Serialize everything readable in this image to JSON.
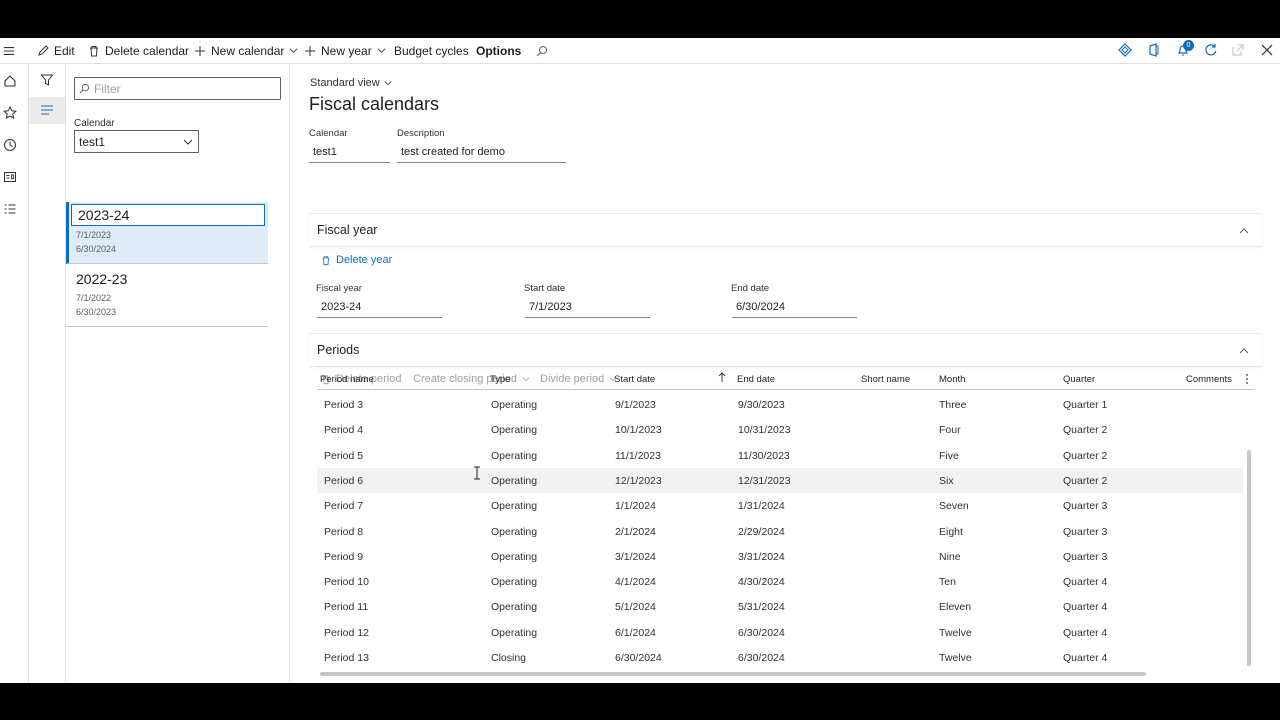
{
  "action_bar": {
    "edit": "Edit",
    "delete_calendar": "Delete calendar",
    "new_calendar": "New calendar",
    "new_year": "New year",
    "budget_cycles": "Budget cycles",
    "options": "Options",
    "notification_count": "0"
  },
  "list": {
    "filter_placeholder": "Filter",
    "calendar_label": "Calendar",
    "calendar_value": "test1",
    "items": [
      {
        "title": "2023-24",
        "start": "7/1/2023",
        "end": "6/30/2024",
        "selected": true
      },
      {
        "title": "2022-23",
        "start": "7/1/2022",
        "end": "6/30/2023",
        "selected": false
      }
    ]
  },
  "main": {
    "view_name": "Standard view",
    "title": "Fiscal calendars",
    "calendar_label": "Calendar",
    "calendar_value": "test1",
    "description_label": "Description",
    "description_value": "test created for demo"
  },
  "fiscal_year_section": {
    "title": "Fiscal year",
    "delete_year": "Delete year",
    "fiscal_year_label": "Fiscal year",
    "fiscal_year_value": "2023-24",
    "start_date_label": "Start date",
    "start_date_value": "7/1/2023",
    "end_date_label": "End date",
    "end_date_value": "6/30/2024"
  },
  "periods_section": {
    "title": "Periods",
    "delete_period": "Delete period",
    "create_closing_period": "Create closing period",
    "divide_period": "Divide period",
    "columns": [
      "Period name",
      "Type",
      "Start date",
      "End date",
      "Short name",
      "Month",
      "Quarter",
      "Comments"
    ],
    "rows": [
      [
        "Period 3",
        "Operating",
        "9/1/2023",
        "9/30/2023",
        "",
        "Three",
        "Quarter 1",
        ""
      ],
      [
        "Period 4",
        "Operating",
        "10/1/2023",
        "10/31/2023",
        "",
        "Four",
        "Quarter 2",
        ""
      ],
      [
        "Period 5",
        "Operating",
        "11/1/2023",
        "11/30/2023",
        "",
        "Five",
        "Quarter 2",
        ""
      ],
      [
        "Period 6",
        "Operating",
        "12/1/2023",
        "12/31/2023",
        "",
        "Six",
        "Quarter 2",
        ""
      ],
      [
        "Period 7",
        "Operating",
        "1/1/2024",
        "1/31/2024",
        "",
        "Seven",
        "Quarter 3",
        ""
      ],
      [
        "Period 8",
        "Operating",
        "2/1/2024",
        "2/29/2024",
        "",
        "Eight",
        "Quarter 3",
        ""
      ],
      [
        "Period 9",
        "Operating",
        "3/1/2024",
        "3/31/2024",
        "",
        "Nine",
        "Quarter 3",
        ""
      ],
      [
        "Period 10",
        "Operating",
        "4/1/2024",
        "4/30/2024",
        "",
        "Ten",
        "Quarter 4",
        ""
      ],
      [
        "Period 11",
        "Operating",
        "5/1/2024",
        "5/31/2024",
        "",
        "Eleven",
        "Quarter 4",
        ""
      ],
      [
        "Period 12",
        "Operating",
        "6/1/2024",
        "6/30/2024",
        "",
        "Twelve",
        "Quarter 4",
        ""
      ],
      [
        "Period 13",
        "Closing",
        "6/30/2024",
        "6/30/2024",
        "",
        "Twelve",
        "Quarter 4",
        ""
      ]
    ]
  },
  "colors": {
    "accent": "#0f6cbd",
    "selected_bg": "#deecf9",
    "hover_row": "#f3f2f1"
  }
}
